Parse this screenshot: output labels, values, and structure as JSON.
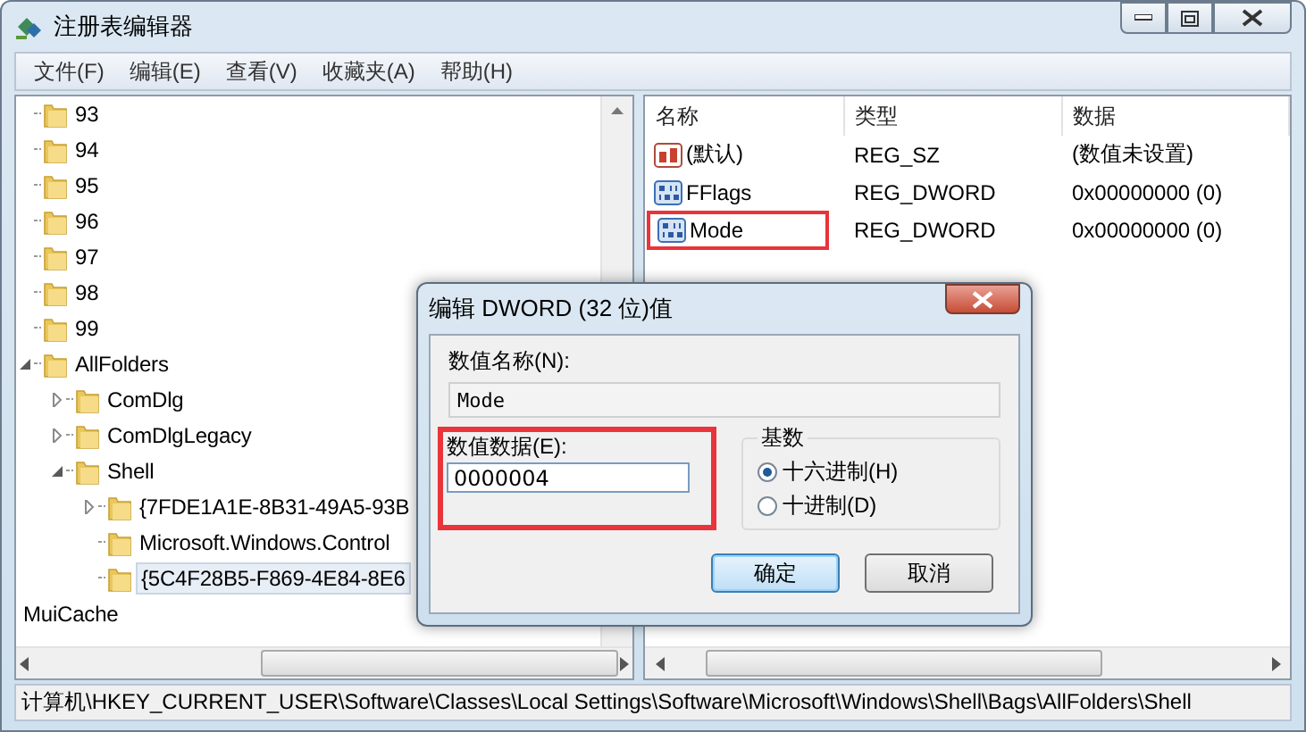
{
  "window": {
    "title": "注册表编辑器"
  },
  "menu": [
    "文件(F)",
    "编辑(E)",
    "查看(V)",
    "收藏夹(A)",
    "帮助(H)"
  ],
  "tree": {
    "items": [
      {
        "label": "93",
        "selected": false
      },
      {
        "label": "94",
        "selected": false
      },
      {
        "label": "95",
        "selected": false
      },
      {
        "label": "96",
        "selected": false
      },
      {
        "label": "97",
        "selected": false
      },
      {
        "label": "98",
        "selected": false
      },
      {
        "label": "99",
        "selected": false
      },
      {
        "label": "AllFolders",
        "expanded": true,
        "selected": false,
        "children": [
          {
            "label": "ComDlg",
            "expanded": false,
            "selected": false
          },
          {
            "label": "ComDlgLegacy",
            "expanded": false,
            "selected": false
          },
          {
            "label": "Shell",
            "expanded": true,
            "selected": false,
            "children": [
              {
                "label": "{7FDE1A1E-8B31-49A5-93B",
                "expanded": false,
                "selected": false
              },
              {
                "label": "Microsoft.Windows.Control",
                "selected": false
              },
              {
                "label": "{5C4F28B5-F869-4E84-8E6",
                "selected": true
              }
            ]
          }
        ]
      }
    ],
    "parent_level_items": [
      {
        "label": "MuiCache"
      }
    ]
  },
  "values": {
    "columns": [
      "名称",
      "类型",
      "数据"
    ],
    "rows": [
      {
        "kind": "string",
        "name": "(默认)",
        "type": "REG_SZ",
        "data": "(数值未设置)",
        "highlighted": false
      },
      {
        "kind": "dword",
        "name": "FFlags",
        "type": "REG_DWORD",
        "data": "0x00000000 (0)",
        "highlighted": false
      },
      {
        "kind": "dword",
        "name": "Mode",
        "type": "REG_DWORD",
        "data": "0x00000000 (0)",
        "highlighted": true
      }
    ]
  },
  "status_bar": "计算机\\HKEY_CURRENT_USER\\Software\\Classes\\Local Settings\\Software\\Microsoft\\Windows\\Shell\\Bags\\AllFolders\\Shell",
  "dialog": {
    "title": "编辑 DWORD (32 位)值",
    "name_label": "数值名称(N):",
    "name_value": "Mode",
    "data_label": "数值数据(E):",
    "data_value": "0000004",
    "data_highlighted": true,
    "base_label": "基数",
    "radios": [
      {
        "label": "十六进制(H)",
        "selected": true
      },
      {
        "label": "十进制(D)",
        "selected": false
      }
    ],
    "buttons": [
      {
        "label": "确定",
        "default": true
      },
      {
        "label": "取消",
        "default": false
      }
    ]
  }
}
